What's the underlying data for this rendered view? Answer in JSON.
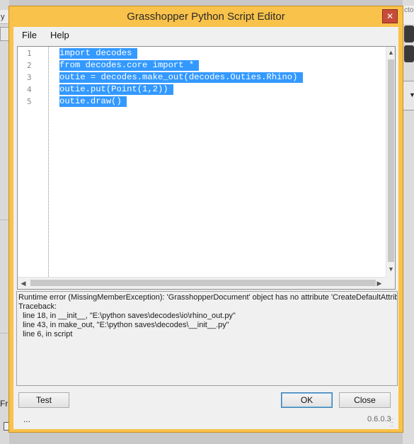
{
  "window": {
    "title": "Grasshopper Python Script Editor",
    "close_glyph": "✕"
  },
  "menu": {
    "file": "File",
    "help": "Help"
  },
  "editor": {
    "line_numbers": [
      "1",
      "2",
      "3",
      "4",
      "5"
    ],
    "lines": [
      "import decodes ",
      "from decodes.core import * ",
      "outie = decodes.make_out(decodes.Outies.Rhino) ",
      "outie.put(Point(1,2)) ",
      "outie.draw() "
    ],
    "selection_color": "#3399ff",
    "selection_text_color": "#ffffff"
  },
  "output": {
    "lines": [
      "Runtime error (MissingMemberException): 'GrasshopperDocument' object has no attribute 'CreateDefaultAttributes'",
      "Traceback:",
      "  line 18, in __init__, \"E:\\python saves\\decodes\\io\\rhino_out.py\"",
      "  line 43, in make_out, \"E:\\python saves\\decodes\\__init__.py\"",
      "  line 6, in script"
    ]
  },
  "buttons": {
    "test": "Test",
    "ok": "OK",
    "close": "Close"
  },
  "status": {
    "left": "...",
    "version": "0.6.0.3"
  },
  "background": {
    "left_top_char": "y",
    "left_bottom_text": "Fro",
    "right_top_text": "cto"
  },
  "colors": {
    "window_frame": "#f9c24a",
    "close_button": "#c74b3a",
    "client_bg": "#f0f0f0"
  }
}
